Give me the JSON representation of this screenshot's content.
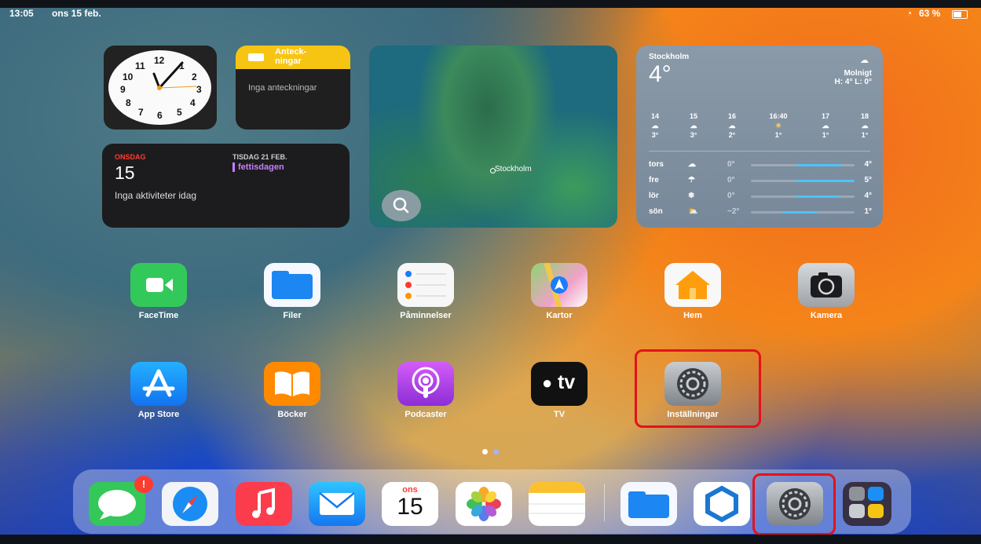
{
  "status_bar": {
    "time": "13:05",
    "date": "ons 15 feb.",
    "battery": "63 %",
    "wifi_icon": "wifi-icon",
    "battery_icon": "battery-icon"
  },
  "clock_widget": {
    "numbers": [
      "12",
      "1",
      "2",
      "3",
      "4",
      "5",
      "6",
      "7",
      "8",
      "9",
      "10",
      "11"
    ]
  },
  "notes_widget": {
    "title": "Anteck-\nningar",
    "empty_text": "Inga anteckningar"
  },
  "calendar_widget": {
    "weekday": "ONSDAG",
    "day": "15",
    "empty_text": "Inga aktiviteter idag",
    "next_date": "TISDAG 21 FEB.",
    "next_event": "fettisdagen"
  },
  "map_widget": {
    "location_label": "Stockholm"
  },
  "weather_widget": {
    "city": "Stockholm",
    "temperature": "4°",
    "condition": "Molnigt",
    "high_low": "H: 4° L: 0°",
    "hourly": [
      {
        "time": "14",
        "icon": "☁",
        "temp": "3°"
      },
      {
        "time": "15",
        "icon": "☁",
        "temp": "3°"
      },
      {
        "time": "16",
        "icon": "☁",
        "temp": "2°"
      },
      {
        "time": "16:40",
        "icon": "☀",
        "temp": "1°"
      },
      {
        "time": "17",
        "icon": "☁",
        "temp": "1°"
      },
      {
        "time": "18",
        "icon": "☁",
        "temp": "1°"
      }
    ],
    "daily": [
      {
        "day": "tors",
        "icon": "☁",
        "low": "0°",
        "high": "4°"
      },
      {
        "day": "fre",
        "icon": "☂",
        "low": "0°",
        "high": "5°"
      },
      {
        "day": "lör",
        "icon": "❄",
        "low": "0°",
        "high": "4°"
      },
      {
        "day": "sön",
        "icon": "⛅",
        "low": "−2°",
        "high": "1°"
      }
    ]
  },
  "apps_row1": [
    {
      "name": "FaceTime",
      "color": "#33c95a"
    },
    {
      "name": "Filer",
      "color": "#f5f8ff"
    },
    {
      "name": "Påminnelser",
      "color": "#f7f7f7"
    },
    {
      "name": "Kartor",
      "color": "#8fd46f"
    },
    {
      "name": "Hem",
      "color": "#f8f8f8"
    },
    {
      "name": "Kamera",
      "color": "#b9bcc1"
    }
  ],
  "apps_row2": [
    {
      "name": "App Store",
      "color": "#1b8ff5"
    },
    {
      "name": "Böcker",
      "color": "#ff8a00"
    },
    {
      "name": "Podcaster",
      "color": "#b84bf2"
    },
    {
      "name": "TV",
      "color": "#111111"
    },
    {
      "name": "Inställningar",
      "color": "#9aa0a6"
    }
  ],
  "tv_label": "tv",
  "dock": {
    "messages_badge": "!",
    "calendar_weekday": "ons",
    "calendar_day": "15"
  },
  "colors": {
    "highlight_red": "#e3121a",
    "page_dot_active": "#ffffff",
    "page_dot_inactive": "#9fb4ff"
  }
}
